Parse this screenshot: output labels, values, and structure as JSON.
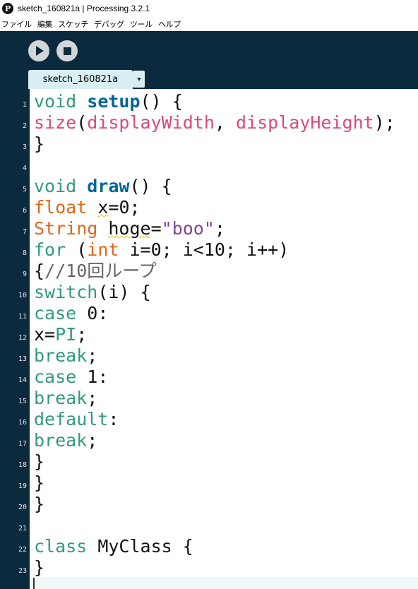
{
  "window": {
    "title": "sketch_160821a | Processing 3.2.1",
    "app_icon_glyph": "P",
    "icon": "processing-logo-icon"
  },
  "menu": {
    "items": [
      "ファイル",
      "編集",
      "スケッチ",
      "デバッグ",
      "ツール",
      "ヘルプ"
    ]
  },
  "toolbar": {
    "run_icon": "play-icon",
    "stop_icon": "stop-icon"
  },
  "tabs": [
    {
      "label": "sketch_160821a",
      "active": true
    }
  ],
  "colors": {
    "chrome_bg": "#0c2a3e",
    "tab_bg": "#d8eef2",
    "keyword_orange": "#e2661a",
    "keyword_green": "#33997e",
    "keyword_blue": "#006699",
    "function_pink": "#d94a7a",
    "string_purple": "#7d4793"
  },
  "editor": {
    "line_numbers": [
      "1",
      "2",
      "3",
      "4",
      "5",
      "6",
      "7",
      "8",
      "9",
      "10",
      "11",
      "12",
      "13",
      "14",
      "15",
      "16",
      "17",
      "18",
      "19",
      "20",
      "21",
      "22",
      "23"
    ],
    "lines": [
      [
        {
          "t": "void",
          "c": "kw-green"
        },
        {
          "t": " "
        },
        {
          "t": "setup",
          "c": "kw-blue"
        },
        {
          "t": "() {"
        }
      ],
      [
        {
          "t": "size",
          "c": "fn-pink"
        },
        {
          "t": "("
        },
        {
          "t": "displayWidth",
          "c": "fn-pink"
        },
        {
          "t": ", "
        },
        {
          "t": "displayHeight",
          "c": "fn-pink"
        },
        {
          "t": ");"
        }
      ],
      [
        {
          "t": "}"
        }
      ],
      [],
      [
        {
          "t": "void",
          "c": "kw-green"
        },
        {
          "t": " "
        },
        {
          "t": "draw",
          "c": "kw-blue"
        },
        {
          "t": "() {"
        }
      ],
      [
        {
          "t": "float",
          "c": "kw-red"
        },
        {
          "t": " "
        },
        {
          "t": "x",
          "c": "squiggle"
        },
        {
          "t": "=0;"
        }
      ],
      [
        {
          "t": "String",
          "c": "kw-red"
        },
        {
          "t": " "
        },
        {
          "t": "hoge",
          "c": "squiggle"
        },
        {
          "t": "="
        },
        {
          "t": "\"boo\"",
          "c": "str-purple"
        },
        {
          "t": ";"
        }
      ],
      [
        {
          "t": "for",
          "c": "kw-green"
        },
        {
          "t": " ("
        },
        {
          "t": "int",
          "c": "kw-red"
        },
        {
          "t": " i=0; i<10; i++)"
        }
      ],
      [
        {
          "t": "{"
        },
        {
          "t": "//10回ループ",
          "c": "cmt-gray"
        }
      ],
      [
        {
          "t": "switch",
          "c": "kw-green"
        },
        {
          "t": "(i) {"
        }
      ],
      [
        {
          "t": "case",
          "c": "kw-green"
        },
        {
          "t": " 0:"
        }
      ],
      [
        {
          "t": "x="
        },
        {
          "t": "PI",
          "c": "kw-green"
        },
        {
          "t": ";"
        }
      ],
      [
        {
          "t": "break",
          "c": "kw-green"
        },
        {
          "t": ";"
        }
      ],
      [
        {
          "t": "case",
          "c": "kw-green"
        },
        {
          "t": " 1:"
        }
      ],
      [
        {
          "t": "break",
          "c": "kw-green"
        },
        {
          "t": ";"
        }
      ],
      [
        {
          "t": "default",
          "c": "kw-green"
        },
        {
          "t": ":"
        }
      ],
      [
        {
          "t": "break",
          "c": "kw-green"
        },
        {
          "t": ";"
        }
      ],
      [
        {
          "t": "}"
        }
      ],
      [
        {
          "t": "}"
        }
      ],
      [
        {
          "t": "}"
        }
      ],
      [],
      [
        {
          "t": "class",
          "c": "kw-green"
        },
        {
          "t": " MyClass {"
        }
      ],
      [
        {
          "t": "}"
        }
      ]
    ]
  }
}
